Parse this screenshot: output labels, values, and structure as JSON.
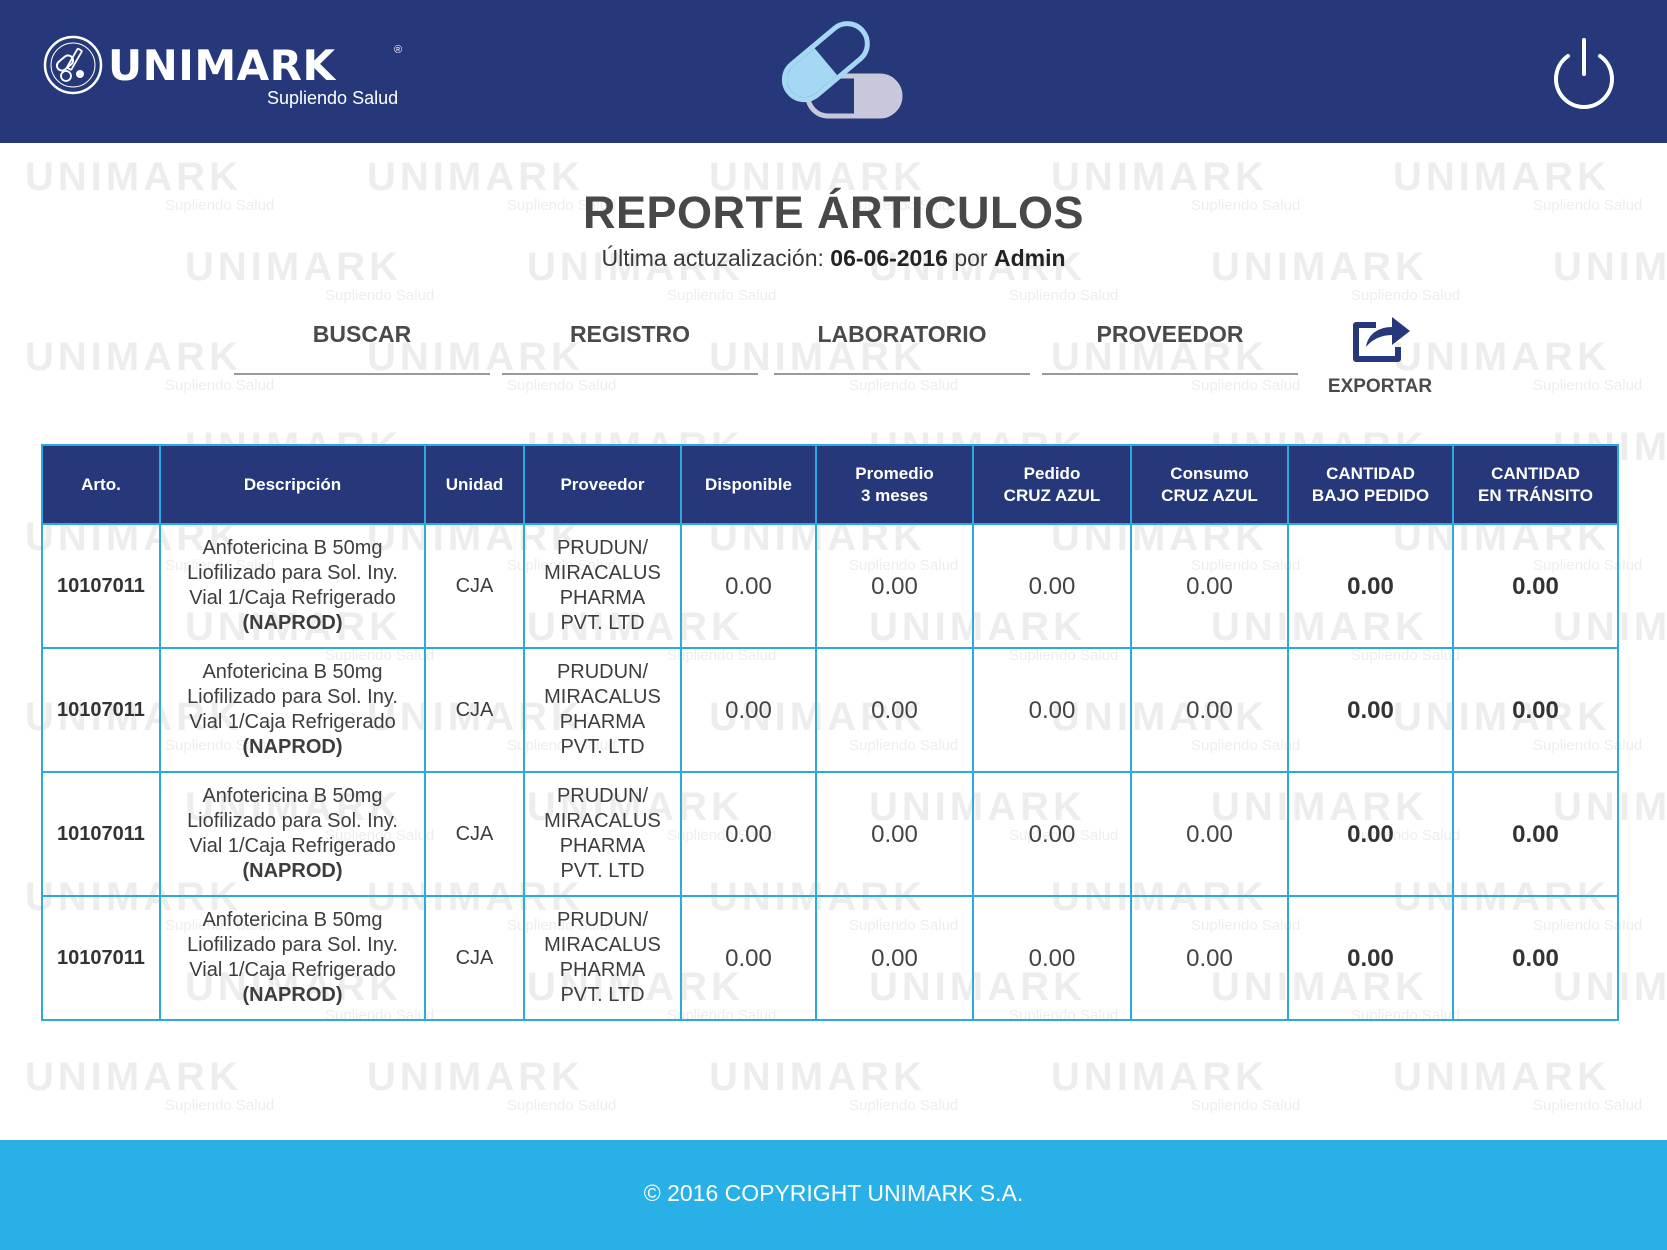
{
  "header": {
    "brand_name": "UNIMARK",
    "brand_reg": "®",
    "brand_tagline": "Supliendo Salud",
    "logo_icon": "medicine-emblem-icon",
    "center_icon": "pill-capsule-icon",
    "power_icon": "power-icon"
  },
  "report": {
    "title": "REPORTE ÁRTICULOS",
    "updated_prefix": "Última actuzalización:",
    "updated_date": "06-06-2016",
    "updated_by_word": "por",
    "updated_user": "Admin"
  },
  "filters": {
    "search_label": "BUSCAR",
    "search_value": "",
    "registry_label": "REGISTRO",
    "registry_value": "",
    "lab_label": "LABORATORIO",
    "lab_value": "",
    "provider_label": "PROVEEDOR",
    "provider_value": ""
  },
  "export": {
    "label": "EXPORTAR",
    "icon": "export-share-icon"
  },
  "table": {
    "columns": [
      "Arto.",
      "Descripción",
      "Unidad",
      "Proveedor",
      "Disponible",
      "Promedio\n3 meses",
      "Pedido\nCRUZ AZUL",
      "Consumo\nCRUZ AZUL",
      "CANTIDAD\nBAJO PEDIDO",
      "CANTIDAD\nEN TRÁNSITO"
    ],
    "rows": [
      {
        "arto": "10107011",
        "desc_main": "Anfotericina B 50mg Liofilizado para Sol. Iny. Vial 1/Caja Refrigerado",
        "desc_lab": "(NAPROD)",
        "unidad": "CJA",
        "proveedor": "PRUDUN/ MIRACALUS PHARMA PVT. LTD",
        "disponible": "0.00",
        "promedio": "0.00",
        "pedido": "0.00",
        "consumo": "0.00",
        "bajo_pedido": "0.00",
        "transito": "0.00"
      },
      {
        "arto": "10107011",
        "desc_main": "Anfotericina B 50mg Liofilizado para Sol. Iny. Vial 1/Caja Refrigerado",
        "desc_lab": "(NAPROD)",
        "unidad": "CJA",
        "proveedor": "PRUDUN/ MIRACALUS PHARMA PVT. LTD",
        "disponible": "0.00",
        "promedio": "0.00",
        "pedido": "0.00",
        "consumo": "0.00",
        "bajo_pedido": "0.00",
        "transito": "0.00"
      },
      {
        "arto": "10107011",
        "desc_main": "Anfotericina B 50mg Liofilizado para Sol. Iny. Vial 1/Caja Refrigerado",
        "desc_lab": "(NAPROD)",
        "unidad": "CJA",
        "proveedor": "PRUDUN/ MIRACALUS PHARMA PVT. LTD",
        "disponible": "0.00",
        "promedio": "0.00",
        "pedido": "0.00",
        "consumo": "0.00",
        "bajo_pedido": "0.00",
        "transito": "0.00"
      },
      {
        "arto": "10107011",
        "desc_main": "Anfotericina B 50mg Liofilizado para Sol. Iny. Vial 1/Caja Refrigerado",
        "desc_lab": "(NAPROD)",
        "unidad": "CJA",
        "proveedor": "PRUDUN/ MIRACALUS PHARMA PVT. LTD",
        "disponible": "0.00",
        "promedio": "0.00",
        "pedido": "0.00",
        "consumo": "0.00",
        "bajo_pedido": "0.00",
        "transito": "0.00"
      }
    ]
  },
  "footer": {
    "copyright": "© 2016 COPYRIGHT UNIMARK S.A."
  },
  "colors": {
    "header_bg": "#263879",
    "footer_bg": "#29b0e6",
    "table_border": "#29abe2",
    "pill_light": "#a5d8f3",
    "pill_dark": "#c7c9db"
  }
}
